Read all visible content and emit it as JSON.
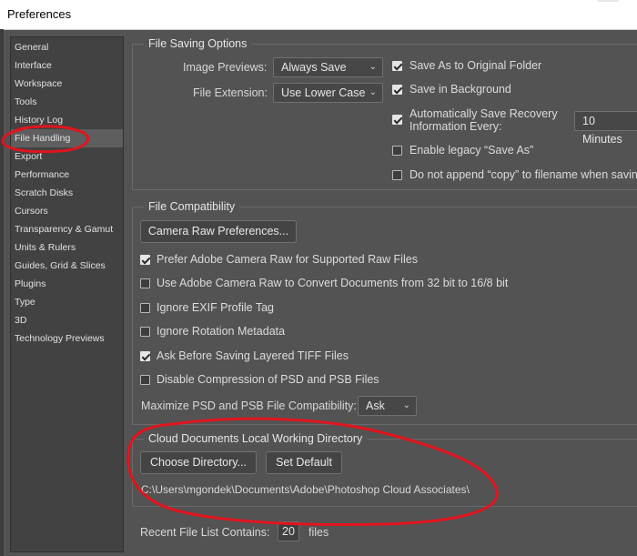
{
  "window": {
    "title": "Preferences"
  },
  "sidebar": {
    "items": [
      {
        "label": "General"
      },
      {
        "label": "Interface"
      },
      {
        "label": "Workspace"
      },
      {
        "label": "Tools"
      },
      {
        "label": "History Log"
      },
      {
        "label": "File Handling"
      },
      {
        "label": "Export"
      },
      {
        "label": "Performance"
      },
      {
        "label": "Scratch Disks"
      },
      {
        "label": "Cursors"
      },
      {
        "label": "Transparency & Gamut"
      },
      {
        "label": "Units & Rulers"
      },
      {
        "label": "Guides, Grid & Slices"
      },
      {
        "label": "Plugins"
      },
      {
        "label": "Type"
      },
      {
        "label": "3D"
      },
      {
        "label": "Technology Previews"
      }
    ],
    "selected": "File Handling"
  },
  "file_saving": {
    "title": "File Saving Options",
    "image_previews_label": "Image Previews:",
    "image_previews_value": "Always Save",
    "file_extension_label": "File Extension:",
    "file_extension_value": "Use Lower Case",
    "save_as_original": {
      "label": "Save As to Original Folder",
      "checked": true
    },
    "save_in_background": {
      "label": "Save in Background",
      "checked": true
    },
    "auto_save": {
      "label_line1": "Automatically Save Recovery",
      "label_line2": "Information Every:",
      "checked": true,
      "interval": "10 Minutes"
    },
    "legacy_save_as": {
      "label": "Enable legacy “Save As”",
      "checked": false
    },
    "no_copy": {
      "label": "Do not append “copy” to filename when savin",
      "checked": false
    }
  },
  "file_compat": {
    "title": "File Compatibility",
    "camera_raw_button": "Camera Raw Preferences...",
    "options": [
      {
        "label": "Prefer Adobe Camera Raw for Supported Raw Files",
        "checked": true
      },
      {
        "label": "Use Adobe Camera Raw to Convert Documents from 32 bit to 16/8 bit",
        "checked": false
      },
      {
        "label": "Ignore EXIF Profile Tag",
        "checked": false
      },
      {
        "label": "Ignore Rotation Metadata",
        "checked": false
      },
      {
        "label": "Ask Before Saving Layered TIFF Files",
        "checked": true
      },
      {
        "label": "Disable Compression of PSD and PSB Files",
        "checked": false
      }
    ],
    "maximize_label": "Maximize PSD and PSB File Compatibility:",
    "maximize_value": "Ask"
  },
  "cloud_docs": {
    "title": "Cloud Documents Local Working Directory",
    "choose_button": "Choose Directory...",
    "default_button": "Set Default",
    "path": "C:\\Users\\mgondek\\Documents\\Adobe\\Photoshop Cloud Associates\\"
  },
  "recent_files": {
    "label": "Recent File List Contains:",
    "value": "20",
    "unit": "files"
  },
  "colors": {
    "background": "#535353",
    "sidebar": "#424242",
    "selected": "#5e5e5e",
    "annotation": "#e0141e"
  }
}
